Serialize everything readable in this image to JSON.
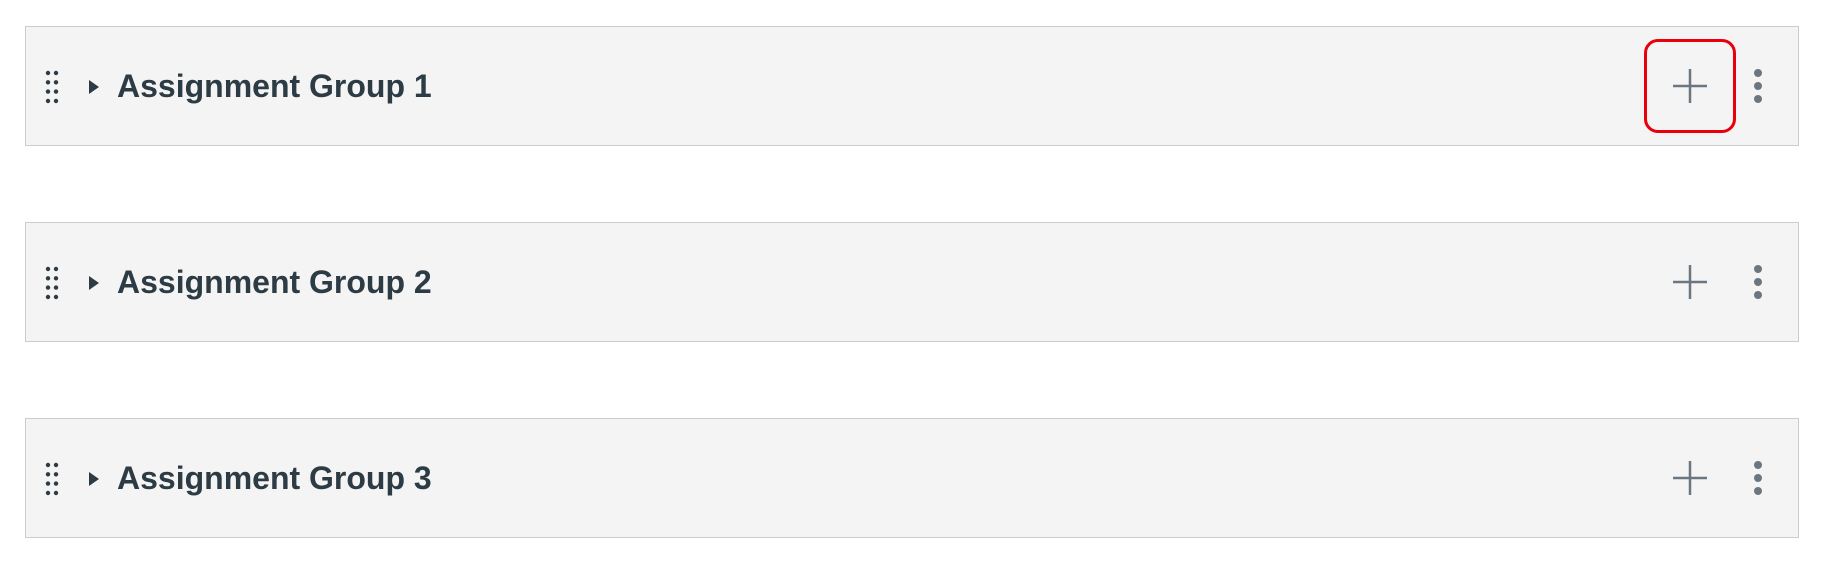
{
  "assignment_groups": [
    {
      "title": "Assignment Group 1",
      "add_highlighted": true
    },
    {
      "title": "Assignment Group 2",
      "add_highlighted": false
    },
    {
      "title": "Assignment Group 3",
      "add_highlighted": false
    }
  ],
  "icons": {
    "drag": "drag-handle-icon",
    "expand": "caret-right-icon",
    "add": "plus-icon",
    "menu": "kebab-menu-icon"
  },
  "colors": {
    "title_text": "#2d3b45",
    "icon_gray": "#6b7780",
    "row_background": "#f4f4f4",
    "row_border": "#c7cdd1",
    "highlight": "#e8000b"
  }
}
